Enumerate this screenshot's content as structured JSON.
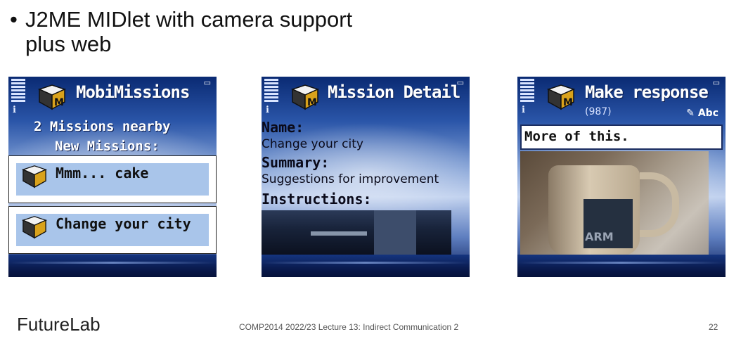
{
  "slide": {
    "bullet_line1": "J2ME MIDlet with camera support",
    "bullet_line2": "plus web",
    "footer_left": "FutureLab",
    "footer_center": "COMP2014 2022/23 Lecture 13: Indirect Communication 2",
    "page_number": "22"
  },
  "screens": {
    "missions": {
      "title": "MobiMissions",
      "nearby": "2 Missions nearby",
      "new_heading": "New Missions:",
      "items": [
        "Mmm... cake",
        "Change your city"
      ]
    },
    "detail": {
      "title": "Mission Detail",
      "name_label": "Name:",
      "name_value": "Change your city",
      "summary_label": "Summary:",
      "summary_value": "Suggestions for improvement",
      "instructions_label": "Instructions:"
    },
    "response": {
      "title": "Make response",
      "count": "(987)",
      "input_mode": "Abc",
      "text_value": "More of this.",
      "photo_text": "ARM"
    }
  },
  "colors": {
    "menu_highlight": "#a9c5ea",
    "screen_dark_blue": "#0a2a73"
  }
}
